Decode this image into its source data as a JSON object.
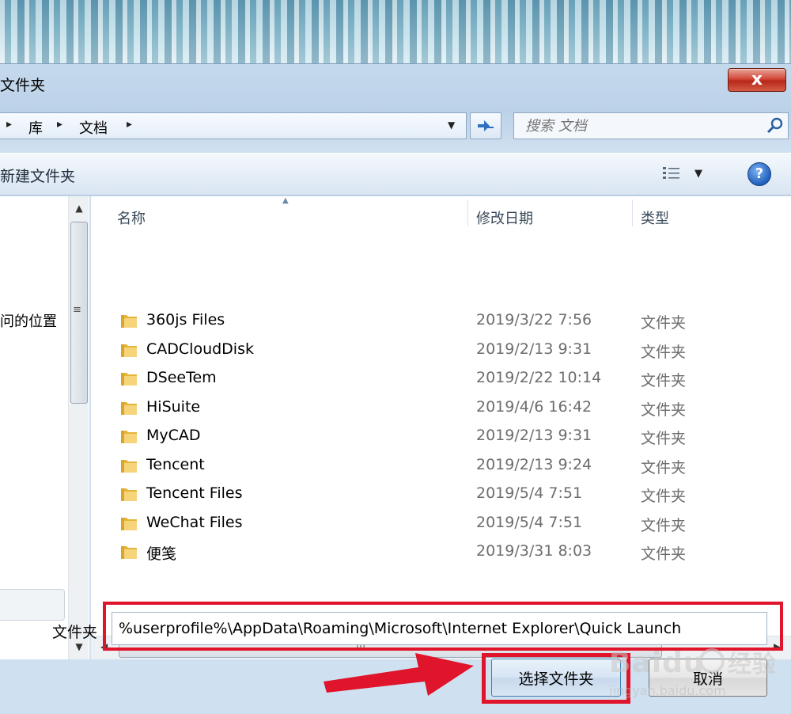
{
  "window": {
    "title": "文件夹",
    "close_label": "x"
  },
  "address": {
    "crumbs": [
      "库",
      "文档"
    ]
  },
  "search": {
    "placeholder": "搜索 文档"
  },
  "toolbar": {
    "new_folder_label": "新建文件夹",
    "help_label": "?"
  },
  "nav": {
    "partial_label": "问的位置"
  },
  "filelist": {
    "columns": [
      "名称",
      "修改日期",
      "类型"
    ],
    "rows": [
      {
        "name": "360js Files",
        "date": "2019/3/22 7:56",
        "type": "文件夹"
      },
      {
        "name": "CADCloudDisk",
        "date": "2019/2/13 9:31",
        "type": "文件夹"
      },
      {
        "name": "DSeeTem",
        "date": "2019/2/22 10:14",
        "type": "文件夹"
      },
      {
        "name": "HiSuite",
        "date": "2019/4/6 16:42",
        "type": "文件夹"
      },
      {
        "name": "MyCAD",
        "date": "2019/2/13 9:31",
        "type": "文件夹"
      },
      {
        "name": "Tencent",
        "date": "2019/2/13 9:24",
        "type": "文件夹"
      },
      {
        "name": "Tencent Files",
        "date": "2019/5/4 7:51",
        "type": "文件夹"
      },
      {
        "name": "WeChat Files",
        "date": "2019/5/4 7:51",
        "type": "文件夹"
      },
      {
        "name": "便笺",
        "date": "2019/3/31 8:03",
        "type": "文件夹"
      }
    ]
  },
  "footer": {
    "folder_label": "文件夹",
    "path_value": "%userprofile%\\AppData\\Roaming\\Microsoft\\Internet Explorer\\Quick Launch",
    "select_label": "选择文件夹",
    "cancel_label": "取消"
  },
  "watermark": {
    "logo_text": "Baidu经验",
    "url_text": "jingyan.baidu.com"
  },
  "colors": {
    "highlight_red": "#e0142a",
    "folder_yellow": "#f2c94c"
  }
}
